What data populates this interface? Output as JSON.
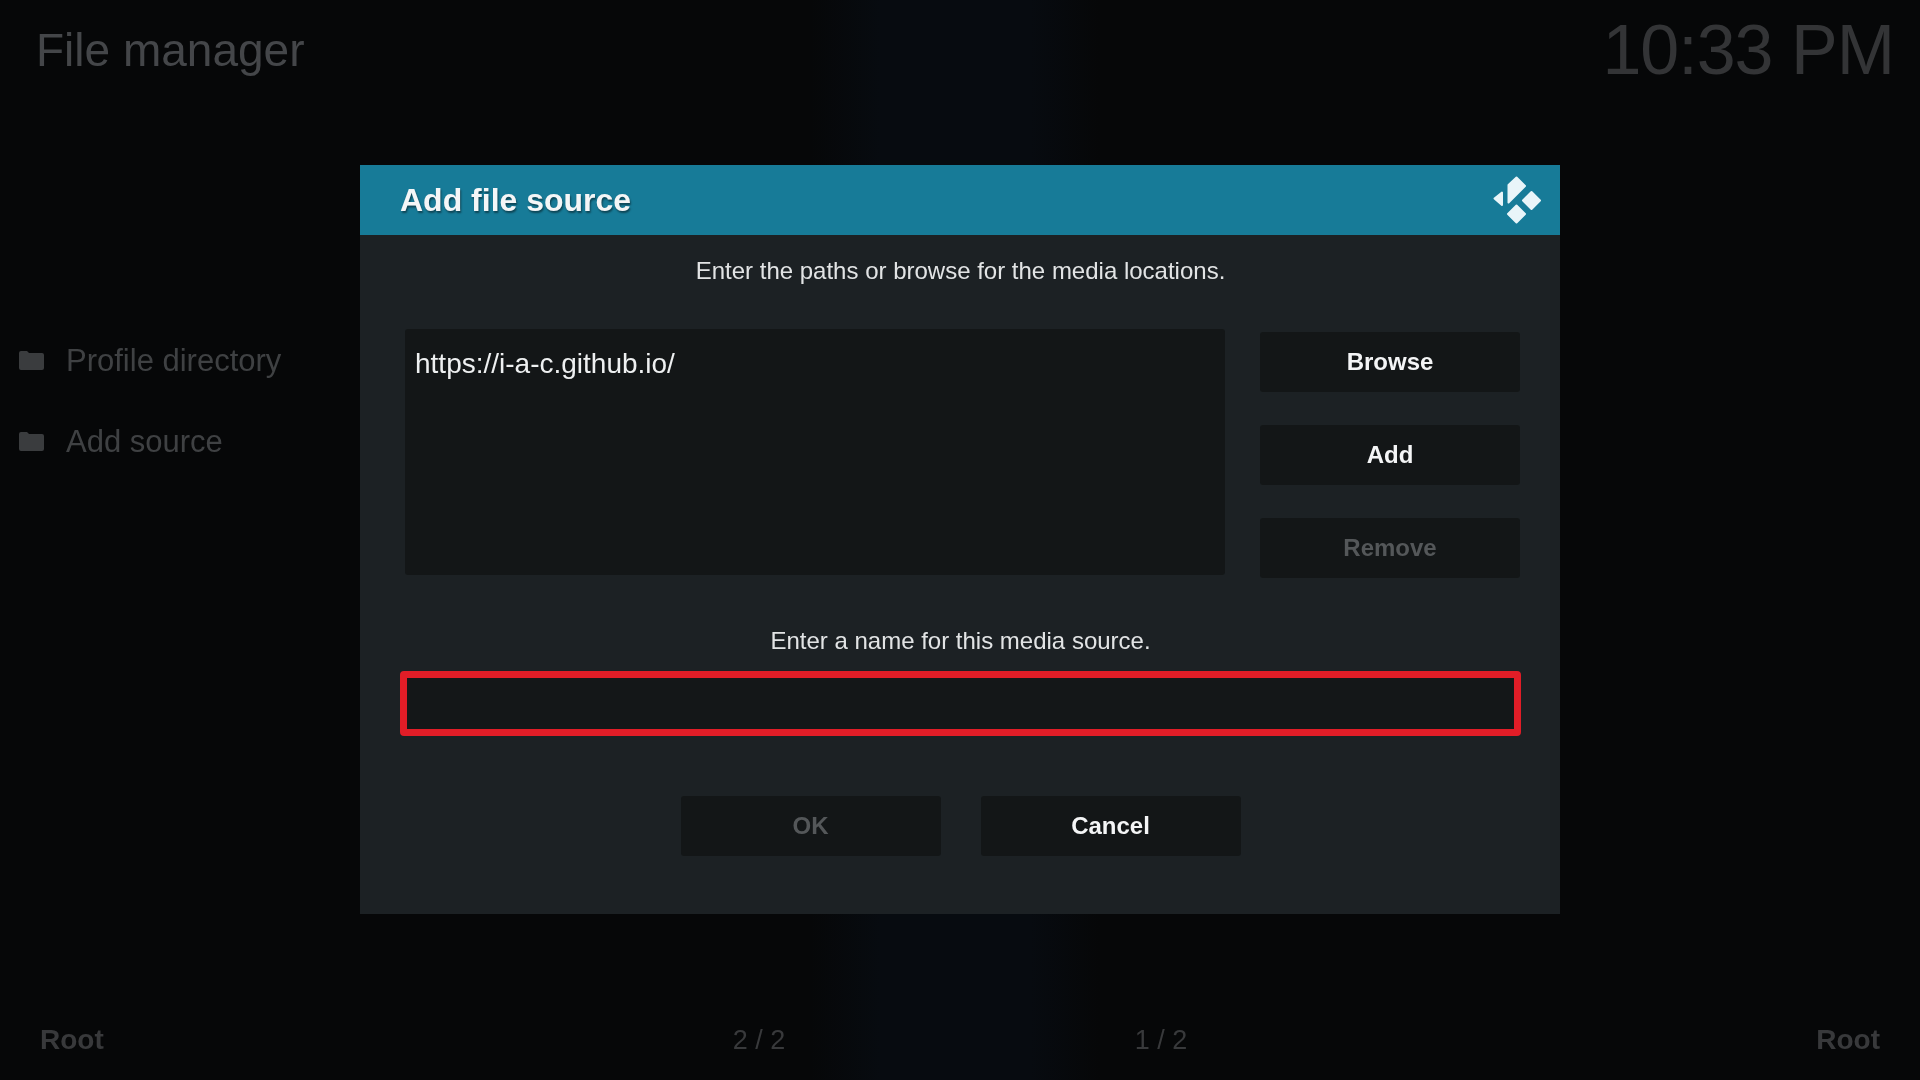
{
  "header": {
    "title": "File manager",
    "clock": "10:33 PM"
  },
  "sidebar": {
    "items": [
      {
        "label": "Profile directory"
      },
      {
        "label": "Add source"
      }
    ]
  },
  "dialog": {
    "title": "Add file source",
    "paths_prompt": "Enter the paths or browse for the media locations.",
    "paths": [
      "https://i-a-c.github.io/"
    ],
    "side_buttons": [
      {
        "label": "Browse",
        "disabled": false
      },
      {
        "label": "Add",
        "disabled": false
      },
      {
        "label": "Remove",
        "disabled": true
      }
    ],
    "name_prompt": "Enter a name for this media source.",
    "name_field": {
      "highlighted": true
    },
    "buttons": [
      {
        "label": "OK",
        "disabled": true
      },
      {
        "label": "Cancel",
        "disabled": false
      }
    ]
  },
  "footer": {
    "left": "Root",
    "page_left": "2 / 2",
    "page_right": "1 / 2",
    "right": "Root"
  }
}
